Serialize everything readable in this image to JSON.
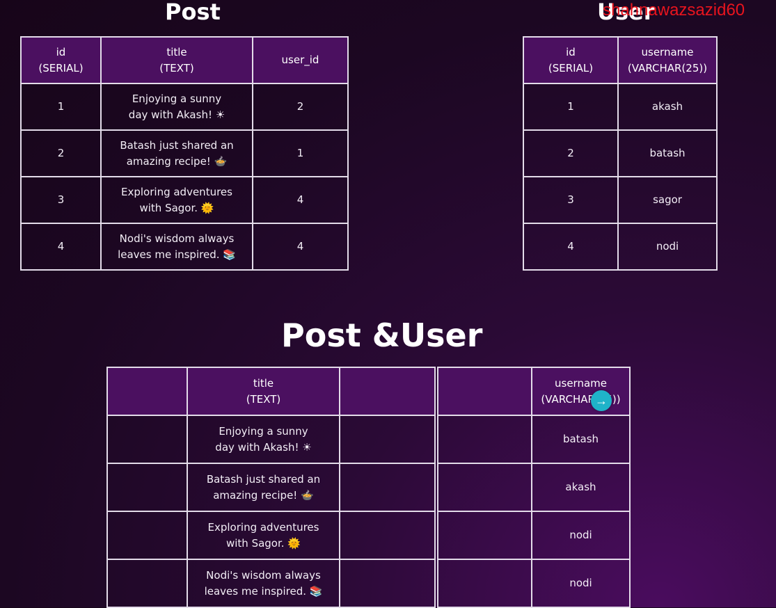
{
  "post_table": {
    "title": "Post",
    "headers": [
      "id\n(SERIAL)",
      "title\n(TEXT)",
      "user_id"
    ],
    "rows": [
      {
        "id": "1",
        "title": "Enjoying a sunny day with Akash! ☀",
        "user_id": "2"
      },
      {
        "id": "2",
        "title": "Batash just shared an amazing recipe! 🍲",
        "user_id": "1"
      },
      {
        "id": "3",
        "title": "Exploring adventures with Sagor. 🌞",
        "user_id": "4"
      },
      {
        "id": "4",
        "title": "Nodi's wisdom always leaves me inspired. 📚",
        "user_id": "4"
      }
    ]
  },
  "user_table": {
    "title": "User",
    "headers": [
      "id\n(SERIAL)",
      "username\n(VARCHAR(25))"
    ],
    "rows": [
      {
        "id": "1",
        "username": "akash"
      },
      {
        "id": "2",
        "username": "batash"
      },
      {
        "id": "3",
        "username": "sagor"
      },
      {
        "id": "4",
        "username": "nodi"
      }
    ]
  },
  "joined_table": {
    "title": "Post &User",
    "headers": [
      "",
      "title\n(TEXT)",
      "",
      "",
      "username\n(VARCHAR(25))"
    ],
    "rows": [
      {
        "title": "Enjoying a sunny day with Akash! ☀",
        "username": "batash"
      },
      {
        "title": "Batash just shared an amazing recipe! 🍲",
        "username": "akash"
      },
      {
        "title": "Exploring adventures with Sagor. 🌞",
        "username": "nodi"
      },
      {
        "title": "Nodi's wisdom always leaves me inspired. 📚",
        "username": "nodi"
      }
    ]
  },
  "watermark": "shahnawazsazid60",
  "cursor_icon": "arrow-right-icon"
}
